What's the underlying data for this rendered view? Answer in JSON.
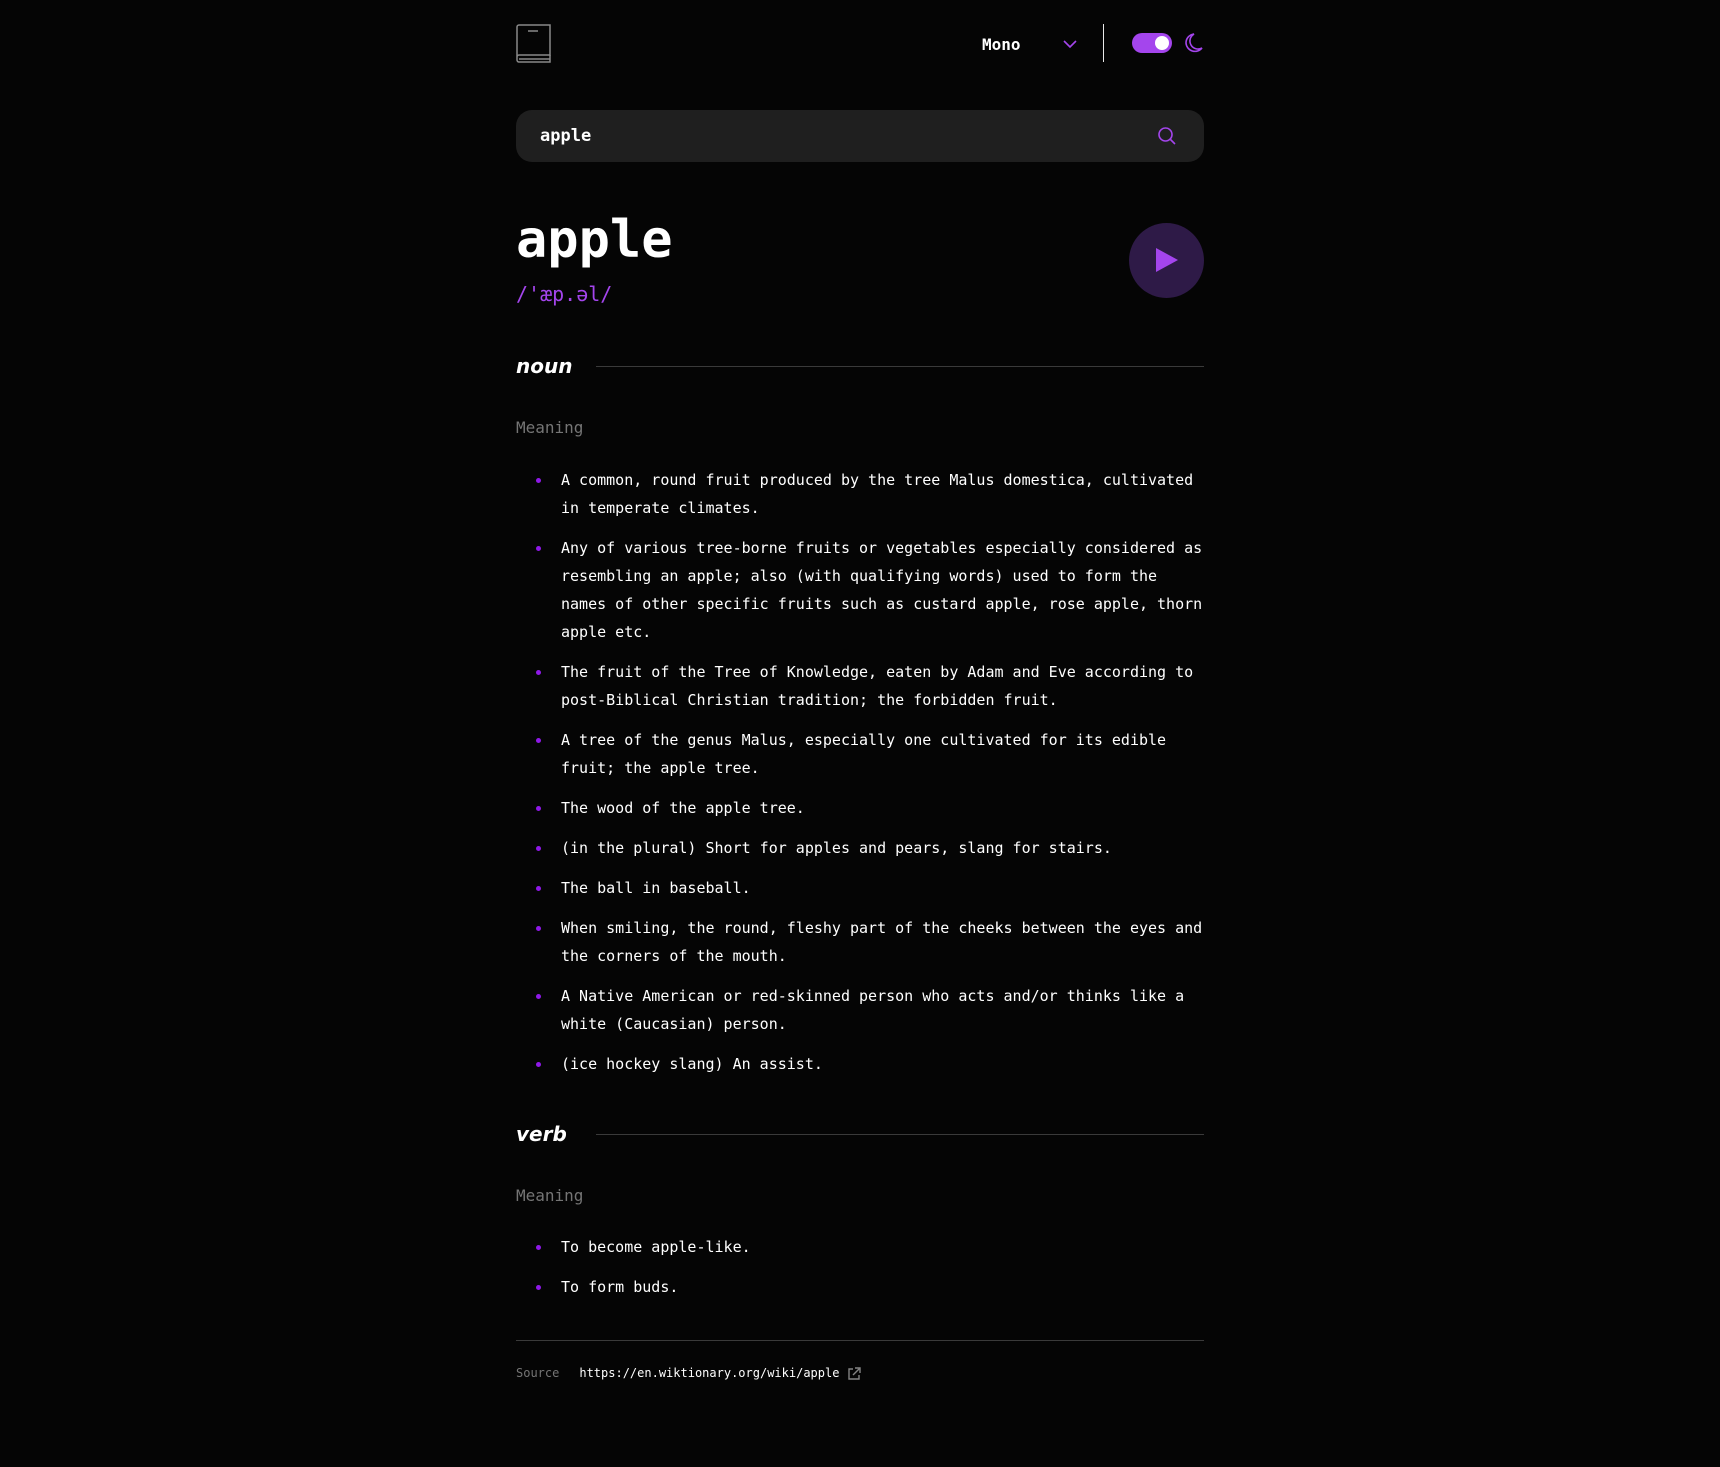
{
  "header": {
    "font_selected": "Mono",
    "icons": {
      "logo": "book-icon",
      "dropdown": "chevron-down-icon",
      "theme": "moon-icon"
    },
    "theme_toggle_on": true
  },
  "search": {
    "value": "apple",
    "icon": "search-icon"
  },
  "entry": {
    "word": "apple",
    "phonetic": "/'æp.əl/",
    "play_icon": "play-icon"
  },
  "meanings": [
    {
      "part_of_speech": "noun",
      "meaning_label": "Meaning",
      "definitions": [
        "A common, round fruit produced by the tree Malus domestica, cultivated in temperate climates.",
        "Any of various tree-borne fruits or vegetables especially considered as resembling an apple; also (with qualifying words) used to form the names of other specific fruits such as custard apple, rose apple, thorn apple etc.",
        "The fruit of the Tree of Knowledge, eaten by Adam and Eve according to post-Biblical Christian tradition; the forbidden fruit.",
        "A tree of the genus Malus, especially one cultivated for its edible fruit; the apple tree.",
        "The wood of the apple tree.",
        "(in the plural) Short for apples and pears, slang for stairs.",
        "The ball in baseball.",
        "When smiling, the round, fleshy part of the cheeks between the eyes and the corners of the mouth.",
        "A Native American or red-skinned person who acts and/or thinks like a white (Caucasian) person.",
        "(ice hockey slang) An assist."
      ]
    },
    {
      "part_of_speech": "verb",
      "meaning_label": "Meaning",
      "definitions": [
        "To become apple-like.",
        "To form buds."
      ]
    }
  ],
  "footer": {
    "source_label": "Source",
    "source_url": "https://en.wiktionary.org/wiki/apple",
    "external_icon": "external-link-icon"
  },
  "colors": {
    "background": "#050505",
    "accent": "#a445ed",
    "search_bg": "#1f1f1f",
    "muted": "#757575",
    "play_bg": "#2e1a47"
  }
}
